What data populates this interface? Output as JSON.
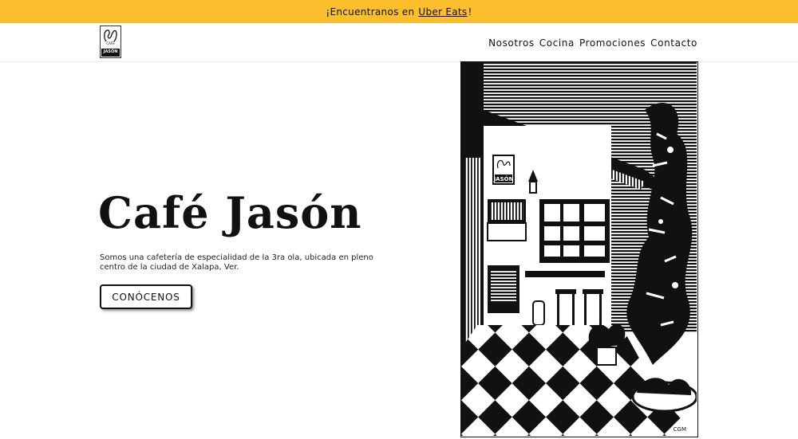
{
  "announcement": {
    "prefix": "¡Encuentranos en ",
    "link": "Uber Eats",
    "suffix": "!"
  },
  "logo": {
    "plate_text": "JASÓN",
    "cafe_text": "CAFÉ"
  },
  "nav": [
    "Nosotros",
    "Cocina",
    "Promociones",
    "Contacto"
  ],
  "hero": {
    "title": "Café Jasón",
    "description": "Somos una cafetería de especialidad de la 3ra ola, ubicada en pleno centro de la ciudad de Xalapa, Ver.",
    "cta": "CONÓCENOS"
  },
  "illustration": {
    "sign_text": "JASÓN",
    "signature": "CGM"
  },
  "colors": {
    "announcement_bg": "#fbbf2e",
    "text": "#111111",
    "background": "#ffffff"
  }
}
